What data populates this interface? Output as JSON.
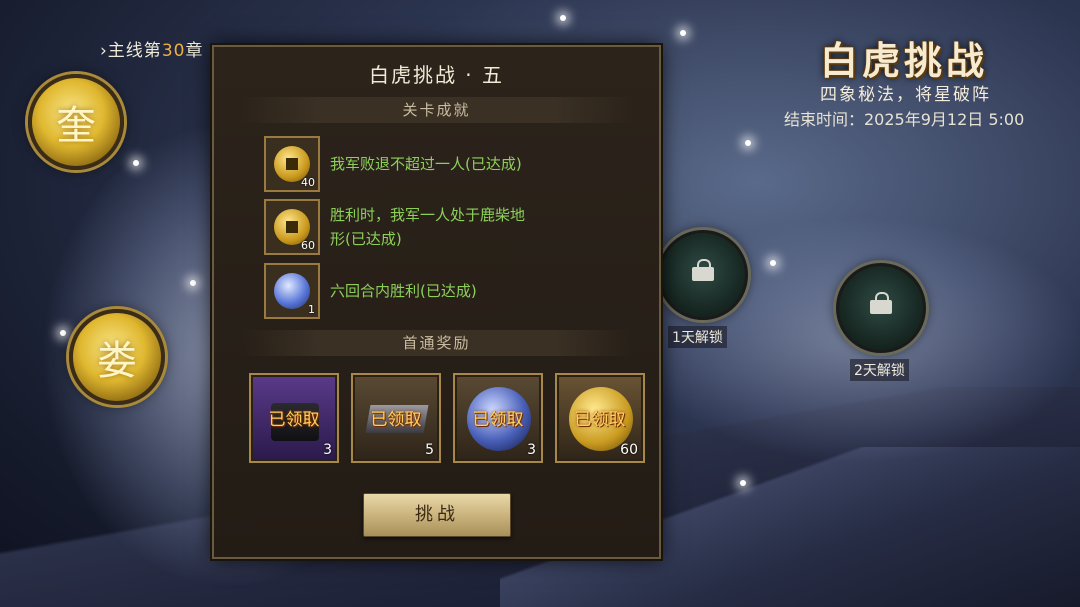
{
  "header": {
    "chapter_prefix": "›主线第",
    "chapter_num": "30",
    "chapter_suffix": "章"
  },
  "constellations": [
    {
      "label": "奎"
    },
    {
      "label": "娄"
    }
  ],
  "event": {
    "title": "白虎挑战",
    "subtitle": "四象秘法，将星破阵",
    "end_time": "结束时间：2025年9月12日 5:00"
  },
  "locked_stages": [
    {
      "label": "1天解锁"
    },
    {
      "label": "2天解锁"
    }
  ],
  "panel": {
    "title": "白虎挑战 · 五",
    "achievements_header": "关卡成就",
    "achievements": [
      {
        "text": "我军败退不超过一人(已达成)",
        "icon": "copper-coin-icon",
        "qty": "40"
      },
      {
        "text_line1": "胜利时，我军一人处于鹿柴地",
        "text_line2": "形(已达成)",
        "icon": "copper-coin-icon",
        "qty": "60"
      },
      {
        "text": "六回合内胜利(已达成)",
        "icon": "blue-orb-icon",
        "qty": "1"
      }
    ],
    "rewards_header": "首通奖励",
    "rewards": [
      {
        "status": "已领取",
        "qty": "3",
        "icon": "mystery-chest-icon"
      },
      {
        "status": "已领取",
        "qty": "5",
        "icon": "iron-ingot-icon"
      },
      {
        "status": "已领取",
        "qty": "3",
        "icon": "blue-orb-icon"
      },
      {
        "status": "已领取",
        "qty": "60",
        "icon": "copper-coin-icon"
      }
    ],
    "challenge_button": "挑战"
  }
}
